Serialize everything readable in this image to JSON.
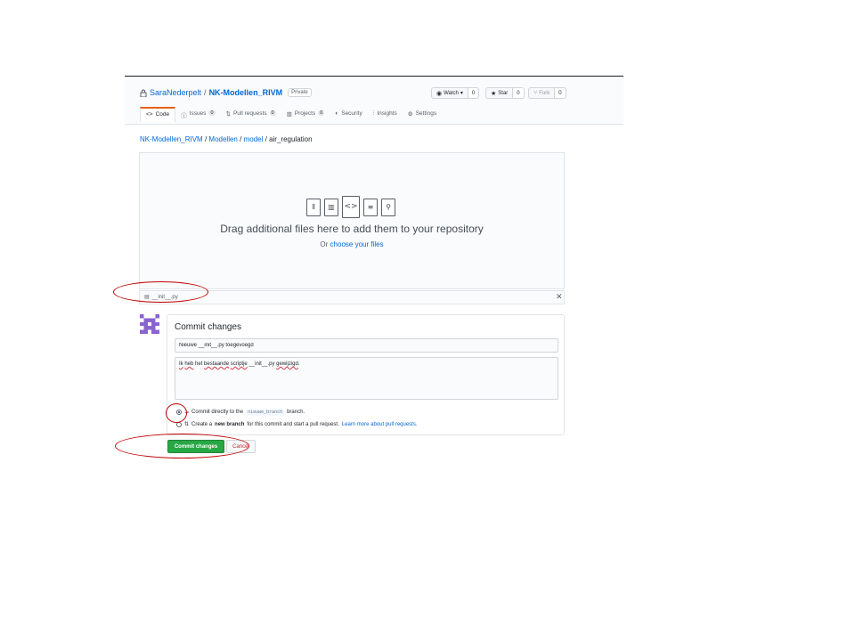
{
  "repo": {
    "owner": "SaraNederpelt",
    "separator": "/",
    "name": "NK-Modellen_RIVM",
    "visibility": "Private"
  },
  "actions": {
    "watch": {
      "label": "Watch",
      "count": "0"
    },
    "star": {
      "label": "Star",
      "count": "0"
    },
    "fork": {
      "label": "Fork",
      "count": "0"
    }
  },
  "tabs": [
    {
      "label": "Code",
      "icon": "code-icon"
    },
    {
      "label": "Issues",
      "count": "0",
      "icon": "issue-icon"
    },
    {
      "label": "Pull requests",
      "count": "0",
      "icon": "pull-request-icon"
    },
    {
      "label": "Projects",
      "count": "0",
      "icon": "project-icon"
    },
    {
      "label": "Security",
      "icon": "shield-icon"
    },
    {
      "label": "Insights",
      "icon": "graph-icon"
    },
    {
      "label": "Settings",
      "icon": "gear-icon"
    }
  ],
  "breadcrumb": {
    "root": "NK-Modellen_RIVM",
    "dir1": "Modellen",
    "dir2": "model",
    "current": "air_regulation",
    "sep": "/"
  },
  "dropzone": {
    "title": "Drag additional files here to add them to your repository",
    "or": "Or",
    "choose_link": "choose your files"
  },
  "uploaded_file": {
    "name": "__init__.py"
  },
  "commit": {
    "heading": "Commit changes",
    "message": "Nieuwe __init__.py toegevoegd",
    "description_pre": "",
    "description_words": [
      "Ik",
      "heb",
      "het",
      "bestaande",
      "scriptje"
    ],
    "description_tail": "__init__.py",
    "description_last": "gewijzigd",
    "option1_pre": "Commit directly to the",
    "option1_branch": "nieuwe_branch",
    "option1_post": "branch.",
    "option2_pre": "Create a",
    "option2_bold": "new branch",
    "option2_post": "for this commit and start a pull request.",
    "option2_link": "Learn more about pull requests.",
    "submit_label": "Commit changes",
    "cancel_label": "Cancel"
  },
  "colors": {
    "link": "#0366d6",
    "primary_button": "#28a745",
    "annotation": "#c00000",
    "tab_accent": "#e36209"
  }
}
